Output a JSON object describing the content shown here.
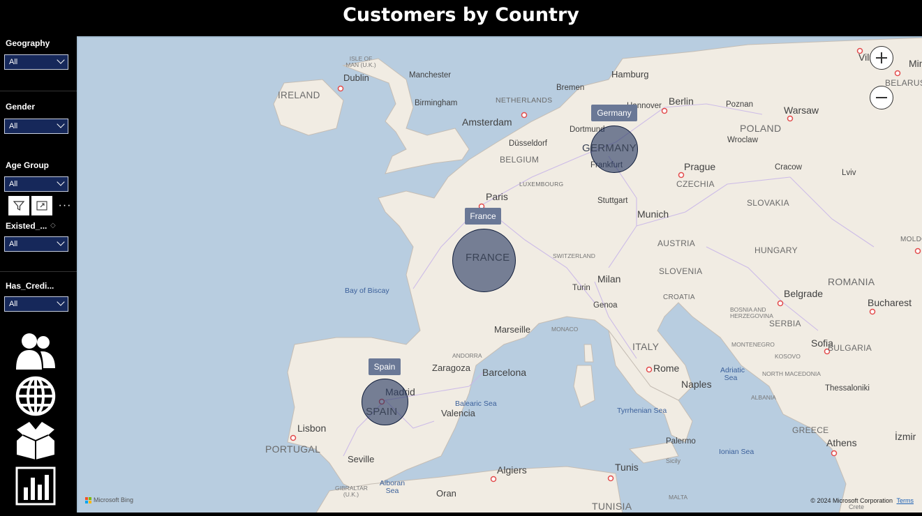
{
  "title": "Customers by Country",
  "slicers": [
    {
      "label": "Geography",
      "value": "All"
    },
    {
      "label": "Gender",
      "value": "All"
    },
    {
      "label": "Age Group",
      "value": "All"
    },
    {
      "label": "Existed_...",
      "value": "All"
    },
    {
      "label": "Has_Credi...",
      "value": "All"
    }
  ],
  "toolbar": {
    "icons": [
      "filter-icon",
      "focus-mode-icon",
      "more-options-icon"
    ],
    "more_label": "···"
  },
  "nav_icons": [
    "customers-icon",
    "globe-icon",
    "box-icon",
    "bar-chart-icon"
  ],
  "map": {
    "countries": [
      {
        "name": "Germany",
        "label": "GERMANY"
      },
      {
        "name": "France",
        "label": "FRANCE"
      },
      {
        "name": "Spain",
        "label": "SPAIN"
      }
    ],
    "cities": [
      "Vilnius",
      "Minsk",
      "Hamburg",
      "Bremen",
      "Hannover",
      "Berlin",
      "Poznan",
      "Warsaw",
      "Dublin",
      "Manchester",
      "Birmingham",
      "Amsterdam",
      "Dortmund",
      "Düsseldorf",
      "Frankfurt",
      "Prague",
      "Cracow",
      "Lviv",
      "Wroclaw",
      "Paris",
      "Stuttgart",
      "Munich",
      "Milan",
      "Turin",
      "Genoa",
      "Marseille",
      "Zaragoza",
      "Barcelona",
      "Madrid",
      "Valencia",
      "Lisbon",
      "Seville",
      "Algiers",
      "Oran",
      "Tunis",
      "Rome",
      "Naples",
      "Palermo",
      "Belgrade",
      "Bucharest",
      "Sofia",
      "Thessaloniki",
      "Athens",
      "İzmir",
      "Crete",
      "Sicily"
    ],
    "country_labels": [
      "IRELAND",
      "NETHERLANDS",
      "BELGIUM",
      "LUXEMBOURG",
      "POLAND",
      "CZECHIA",
      "SLOVAKIA",
      "AUSTRIA",
      "HUNGARY",
      "SLOVENIA",
      "CROATIA",
      "ROMANIA",
      "SERBIA",
      "BULGARIA",
      "ITALY",
      "PORTUGAL",
      "TUNISIA",
      "GREECE",
      "SWITZERLAND",
      "MONACO",
      "ANDORRA",
      "MONTENEGRO",
      "KOSOVO",
      "NORTH MACEDONIA",
      "ALBANIA",
      "BOSNIA AND HERZEGOVINA",
      "ISLE OF MAN (U.K.)",
      "GIBRALTAR (U.K.)",
      "MALTA",
      "BELARUS",
      "MOLDOVA"
    ],
    "seas": [
      "Bay of Biscay",
      "Balearic Sea",
      "Alboran Sea",
      "Tyrrhenian Sea",
      "Adriatic Sea",
      "Ionian Sea"
    ],
    "attribution": {
      "bing": "Microsoft Bing",
      "copyright": "© 2024 Microsoft Corporation",
      "terms": "Terms"
    }
  }
}
